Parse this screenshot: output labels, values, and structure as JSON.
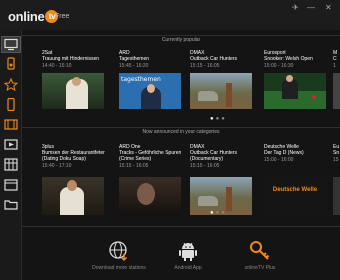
{
  "app": {
    "logo_prefix": "online",
    "logo_badge": "tv",
    "edition": "Free"
  },
  "window_controls": {
    "pin": "✈",
    "minimize": "—",
    "close": "✕"
  },
  "sidebar": {
    "items": [
      {
        "icon": "tv-icon",
        "active": true
      },
      {
        "icon": "radio-icon"
      },
      {
        "icon": "star-icon"
      },
      {
        "icon": "mobile-icon"
      },
      {
        "icon": "film-icon"
      },
      {
        "icon": "video-icon"
      },
      {
        "icon": "grid-icon"
      },
      {
        "icon": "calendar-icon"
      },
      {
        "icon": "folder-icon"
      }
    ]
  },
  "sections": {
    "popular": {
      "title": "Currently popular",
      "items": [
        {
          "channel": "2Sat",
          "title": "Trauung mit Hindernissen",
          "time": "14:40 - 16:10"
        },
        {
          "channel": "ARD",
          "title": "Tagesthemen",
          "time": "15:45 - 16:20"
        },
        {
          "channel": "DMAX",
          "title": "Outback Car Hunters",
          "time": "15:15 - 16:05"
        },
        {
          "channel": "Eurosport",
          "title": "Snooker: Welsh Open",
          "time": "15:00 - 16:30"
        },
        {
          "channel": "M",
          "title": "C",
          "time": "1"
        }
      ]
    },
    "announced": {
      "title": "Now announced in your categories",
      "items": [
        {
          "channel": "3plus",
          "title": "Bumsen der Restaurantfeter (Dating Doku Soap)",
          "time": "15:40 - 17:10"
        },
        {
          "channel": "ARD One",
          "title": "Tracks - Geföhrliche Spuren (Crime Series)",
          "time": "15:15 - 16:05"
        },
        {
          "channel": "DMAX",
          "title": "Outback Car Hunters (Documentary)",
          "time": "15:15 - 16:05"
        },
        {
          "channel": "Deutsche Welle",
          "title": "Der Tag D (News)",
          "time": "15:00 - 16:00"
        },
        {
          "channel": "Eu",
          "title": "Sn",
          "time": "15"
        }
      ]
    }
  },
  "thumb_texts": {
    "tagesthemen": "tagesthemen",
    "dw": "Deutsche Welle"
  },
  "bottom": {
    "download_stations": "Download more stations",
    "android_app": "Android App",
    "premium": "onlineTV Plus"
  },
  "colors": {
    "accent": "#f08a1a",
    "background": "#141414"
  }
}
